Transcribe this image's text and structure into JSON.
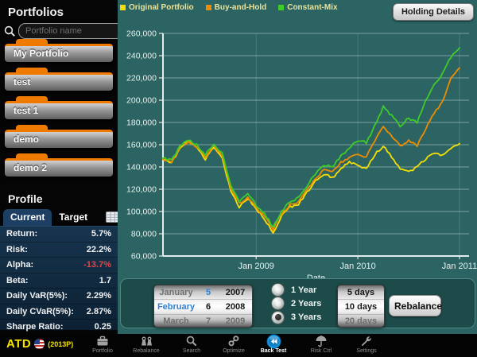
{
  "sidebar": {
    "title": "Portfolios",
    "search_placeholder": "Portfolio name",
    "portfolios": [
      "My Portfolio",
      "test",
      "test 1",
      "demo",
      "demo 2"
    ],
    "profile": {
      "title": "Profile",
      "tabs": [
        "Current",
        "Target"
      ],
      "active_tab": "Current",
      "stats": [
        {
          "label": "Return:",
          "value": "5.7%"
        },
        {
          "label": "Risk:",
          "value": "22.2%"
        },
        {
          "label": "Alpha:",
          "value": "-13.7%"
        },
        {
          "label": "Beta:",
          "value": "1.7"
        },
        {
          "label": "Daily VaR(5%):",
          "value": "2.29%"
        },
        {
          "label": "Daily CVaR(5%):",
          "value": "2.87%"
        },
        {
          "label": "Sharpe Ratio:",
          "value": "0.25"
        }
      ]
    }
  },
  "header": {
    "holding_details_label": "Holding Details"
  },
  "chart_data": {
    "type": "line",
    "xlabel": "Date",
    "ylabel": "",
    "ylim": [
      60000,
      260000
    ],
    "ytick_step": 20000,
    "xticks": [
      {
        "label": "Jan 2009",
        "index": 11
      },
      {
        "label": "Jan 2010",
        "index": 23
      },
      {
        "label": "Jan 2011",
        "index": 35
      }
    ],
    "x": [
      "2008-02",
      "2008-03",
      "2008-04",
      "2008-05",
      "2008-06",
      "2008-07",
      "2008-08",
      "2008-09",
      "2008-10",
      "2008-11",
      "2008-12",
      "2009-01",
      "2009-02",
      "2009-03",
      "2009-04",
      "2009-05",
      "2009-06",
      "2009-07",
      "2009-08",
      "2009-09",
      "2009-10",
      "2009-11",
      "2009-12",
      "2010-01",
      "2010-02",
      "2010-03",
      "2010-04",
      "2010-05",
      "2010-06",
      "2010-07",
      "2010-08",
      "2010-09",
      "2010-10",
      "2010-11",
      "2010-12",
      "2011-01"
    ],
    "grid": true,
    "legend_position": "top-left",
    "series": [
      {
        "name": "Original Portfolio",
        "color": "#f5df00",
        "values": [
          147000,
          144000,
          156000,
          164000,
          157000,
          147000,
          158000,
          148000,
          118000,
          104000,
          112000,
          102000,
          93000,
          81000,
          96000,
          104000,
          107000,
          117000,
          127000,
          134000,
          130000,
          139000,
          144000,
          141000,
          139000,
          151000,
          159000,
          149000,
          139000,
          135000,
          140000,
          147000,
          152000,
          150000,
          156000,
          161000
        ]
      },
      {
        "name": "Buy-and-Hold",
        "color": "#f08c00",
        "values": [
          147000,
          145000,
          157000,
          163000,
          158000,
          149000,
          159000,
          150000,
          121000,
          107000,
          113000,
          104000,
          96000,
          84000,
          98000,
          106000,
          109000,
          119000,
          130000,
          137000,
          135000,
          144000,
          149000,
          151000,
          149000,
          163000,
          176000,
          168000,
          159000,
          164000,
          159000,
          174000,
          188000,
          199000,
          219000,
          229000
        ]
      },
      {
        "name": "Constant-Mix",
        "color": "#3ecc28",
        "values": [
          148000,
          146000,
          158000,
          165000,
          160000,
          151000,
          161000,
          152000,
          123000,
          109000,
          115000,
          106000,
          98000,
          86000,
          100000,
          109000,
          112000,
          123000,
          134000,
          142000,
          140000,
          150000,
          157000,
          164000,
          162000,
          177000,
          194000,
          186000,
          177000,
          184000,
          180000,
          199000,
          214000,
          224000,
          239000,
          247000
        ]
      }
    ]
  },
  "controls": {
    "date_picker": {
      "rows": [
        [
          "January",
          "5",
          "2007"
        ],
        [
          "February",
          "6",
          "2008"
        ],
        [
          "March",
          "7",
          "2009"
        ]
      ],
      "cell_styles": [
        [
          "dim",
          "blue",
          "dark"
        ],
        [
          "blue",
          "dark",
          "dark"
        ],
        [
          "dim",
          "dim",
          "dim"
        ]
      ],
      "selected_row": 1
    },
    "period_options": [
      {
        "label": "1 Year",
        "selected": false
      },
      {
        "label": "2 Years",
        "selected": false
      },
      {
        "label": "3 Years",
        "selected": true
      }
    ],
    "rebalance_days": [
      {
        "label": "5 days",
        "style": "dark"
      },
      {
        "label": "10 days",
        "style": "dark"
      },
      {
        "label": "20 days",
        "style": "dim"
      }
    ],
    "rebalance_label": "Rebalance"
  },
  "toolbar": {
    "logo": "ATD",
    "logo_suffix": "(2013P)",
    "flag_icon": "us-flag-icon",
    "items": [
      {
        "label": "Portfolio",
        "icon": "briefcase-icon",
        "active": false
      },
      {
        "label": "Rebalance",
        "icon": "scales-icon",
        "active": false
      },
      {
        "label": "Search",
        "icon": "search-icon",
        "active": false
      },
      {
        "label": "Optimize",
        "icon": "gears-icon",
        "active": false
      },
      {
        "label": "Back Test",
        "icon": "rewind-icon",
        "active": true
      },
      {
        "label": "Risk Ctrl",
        "icon": "umbrella-icon",
        "active": false
      },
      {
        "label": "Settings",
        "icon": "wrench-icon",
        "active": false
      }
    ]
  },
  "colors": {
    "teal_background": "#2b6462",
    "accent_orange": "#f07a00",
    "backtest_blue": "#17a0e8",
    "negative_red": "#e04848"
  }
}
